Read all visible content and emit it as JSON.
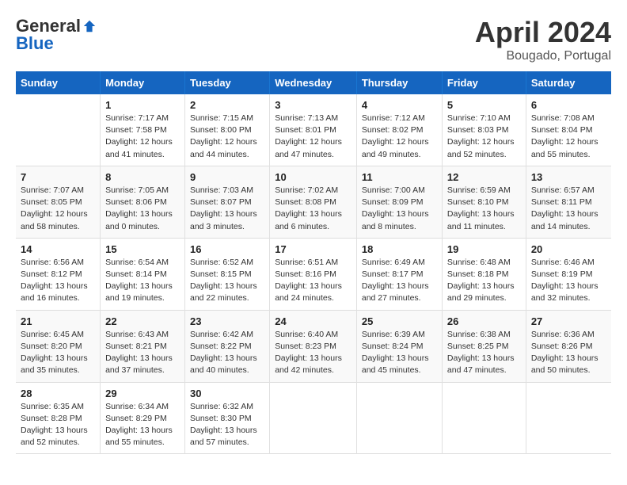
{
  "logo": {
    "general": "General",
    "blue": "Blue"
  },
  "title": "April 2024",
  "location": "Bougado, Portugal",
  "days_header": [
    "Sunday",
    "Monday",
    "Tuesday",
    "Wednesday",
    "Thursday",
    "Friday",
    "Saturday"
  ],
  "weeks": [
    [
      {
        "num": "",
        "info": ""
      },
      {
        "num": "1",
        "info": "Sunrise: 7:17 AM\nSunset: 7:58 PM\nDaylight: 12 hours\nand 41 minutes."
      },
      {
        "num": "2",
        "info": "Sunrise: 7:15 AM\nSunset: 8:00 PM\nDaylight: 12 hours\nand 44 minutes."
      },
      {
        "num": "3",
        "info": "Sunrise: 7:13 AM\nSunset: 8:01 PM\nDaylight: 12 hours\nand 47 minutes."
      },
      {
        "num": "4",
        "info": "Sunrise: 7:12 AM\nSunset: 8:02 PM\nDaylight: 12 hours\nand 49 minutes."
      },
      {
        "num": "5",
        "info": "Sunrise: 7:10 AM\nSunset: 8:03 PM\nDaylight: 12 hours\nand 52 minutes."
      },
      {
        "num": "6",
        "info": "Sunrise: 7:08 AM\nSunset: 8:04 PM\nDaylight: 12 hours\nand 55 minutes."
      }
    ],
    [
      {
        "num": "7",
        "info": "Sunrise: 7:07 AM\nSunset: 8:05 PM\nDaylight: 12 hours\nand 58 minutes."
      },
      {
        "num": "8",
        "info": "Sunrise: 7:05 AM\nSunset: 8:06 PM\nDaylight: 13 hours\nand 0 minutes."
      },
      {
        "num": "9",
        "info": "Sunrise: 7:03 AM\nSunset: 8:07 PM\nDaylight: 13 hours\nand 3 minutes."
      },
      {
        "num": "10",
        "info": "Sunrise: 7:02 AM\nSunset: 8:08 PM\nDaylight: 13 hours\nand 6 minutes."
      },
      {
        "num": "11",
        "info": "Sunrise: 7:00 AM\nSunset: 8:09 PM\nDaylight: 13 hours\nand 8 minutes."
      },
      {
        "num": "12",
        "info": "Sunrise: 6:59 AM\nSunset: 8:10 PM\nDaylight: 13 hours\nand 11 minutes."
      },
      {
        "num": "13",
        "info": "Sunrise: 6:57 AM\nSunset: 8:11 PM\nDaylight: 13 hours\nand 14 minutes."
      }
    ],
    [
      {
        "num": "14",
        "info": "Sunrise: 6:56 AM\nSunset: 8:12 PM\nDaylight: 13 hours\nand 16 minutes."
      },
      {
        "num": "15",
        "info": "Sunrise: 6:54 AM\nSunset: 8:14 PM\nDaylight: 13 hours\nand 19 minutes."
      },
      {
        "num": "16",
        "info": "Sunrise: 6:52 AM\nSunset: 8:15 PM\nDaylight: 13 hours\nand 22 minutes."
      },
      {
        "num": "17",
        "info": "Sunrise: 6:51 AM\nSunset: 8:16 PM\nDaylight: 13 hours\nand 24 minutes."
      },
      {
        "num": "18",
        "info": "Sunrise: 6:49 AM\nSunset: 8:17 PM\nDaylight: 13 hours\nand 27 minutes."
      },
      {
        "num": "19",
        "info": "Sunrise: 6:48 AM\nSunset: 8:18 PM\nDaylight: 13 hours\nand 29 minutes."
      },
      {
        "num": "20",
        "info": "Sunrise: 6:46 AM\nSunset: 8:19 PM\nDaylight: 13 hours\nand 32 minutes."
      }
    ],
    [
      {
        "num": "21",
        "info": "Sunrise: 6:45 AM\nSunset: 8:20 PM\nDaylight: 13 hours\nand 35 minutes."
      },
      {
        "num": "22",
        "info": "Sunrise: 6:43 AM\nSunset: 8:21 PM\nDaylight: 13 hours\nand 37 minutes."
      },
      {
        "num": "23",
        "info": "Sunrise: 6:42 AM\nSunset: 8:22 PM\nDaylight: 13 hours\nand 40 minutes."
      },
      {
        "num": "24",
        "info": "Sunrise: 6:40 AM\nSunset: 8:23 PM\nDaylight: 13 hours\nand 42 minutes."
      },
      {
        "num": "25",
        "info": "Sunrise: 6:39 AM\nSunset: 8:24 PM\nDaylight: 13 hours\nand 45 minutes."
      },
      {
        "num": "26",
        "info": "Sunrise: 6:38 AM\nSunset: 8:25 PM\nDaylight: 13 hours\nand 47 minutes."
      },
      {
        "num": "27",
        "info": "Sunrise: 6:36 AM\nSunset: 8:26 PM\nDaylight: 13 hours\nand 50 minutes."
      }
    ],
    [
      {
        "num": "28",
        "info": "Sunrise: 6:35 AM\nSunset: 8:28 PM\nDaylight: 13 hours\nand 52 minutes."
      },
      {
        "num": "29",
        "info": "Sunrise: 6:34 AM\nSunset: 8:29 PM\nDaylight: 13 hours\nand 55 minutes."
      },
      {
        "num": "30",
        "info": "Sunrise: 6:32 AM\nSunset: 8:30 PM\nDaylight: 13 hours\nand 57 minutes."
      },
      {
        "num": "",
        "info": ""
      },
      {
        "num": "",
        "info": ""
      },
      {
        "num": "",
        "info": ""
      },
      {
        "num": "",
        "info": ""
      }
    ]
  ]
}
